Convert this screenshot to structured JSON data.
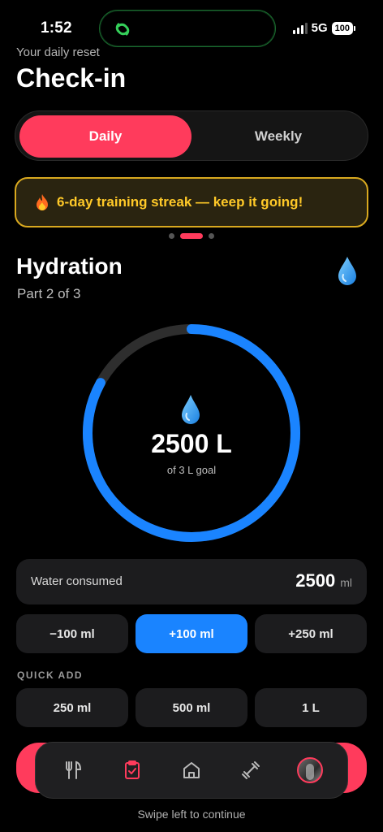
{
  "status": {
    "time": "1:52",
    "network": "5G",
    "battery": "100"
  },
  "header": {
    "subtitle": "Your daily reset",
    "title": "Check-in"
  },
  "segment": {
    "daily": "Daily",
    "weekly": "Weekly",
    "selected": "Daily"
  },
  "banner": {
    "text": "6-day training streak — keep it going!"
  },
  "pager": {
    "count": 3,
    "active": 2
  },
  "section": {
    "title": "Hydration",
    "part": "Part 2 of 3"
  },
  "ring": {
    "value": "2500 L",
    "goal": "of 3 L goal",
    "progress": 0.83,
    "colors": {
      "track": "#2e2e2e",
      "fill": "#1a84ff"
    }
  },
  "water": {
    "label": "Water consumed",
    "value": "2500",
    "unit": "ml"
  },
  "adjust": [
    "−100 ml",
    "+100 ml",
    "+250 ml"
  ],
  "quick_add": {
    "label": "QUICK ADD",
    "options": [
      "250 ml",
      "500 ml",
      "1 L"
    ]
  },
  "tabs": [
    "nutrition",
    "check-in",
    "home",
    "workouts",
    "profile"
  ],
  "footer": {
    "hint": "Swipe left to continue"
  },
  "colors": {
    "accent": "#ff3b5c",
    "blue": "#1a84ff",
    "streak": "#ffc928"
  }
}
